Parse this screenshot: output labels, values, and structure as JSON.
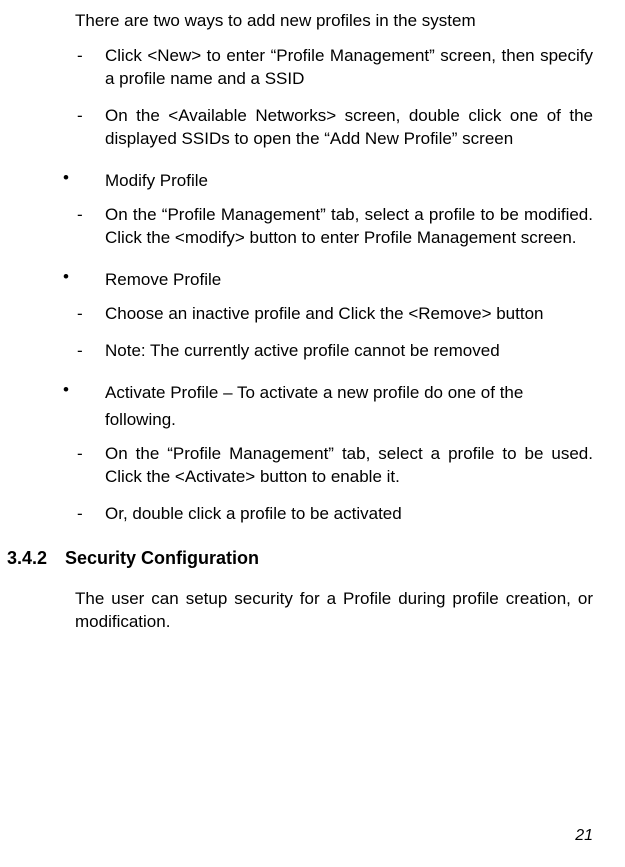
{
  "intro": "There are two ways to add new profiles in the system",
  "addMethods": {
    "item1": "Click <New> to enter “Profile Management” screen, then specify a profile name and a SSID",
    "item2": "On the <Available Networks> screen, double click one of the displayed SSIDs to open the “Add New Profile” screen"
  },
  "modify": {
    "title": "Modify Profile",
    "item1": "On the “Profile Management” tab, select a profile to be modified. Click the <modify> button to enter Profile Management screen."
  },
  "remove": {
    "title": "Remove Profile",
    "item1": "Choose an inactive profile and Click the <Remove> button",
    "item2": "Note: The currently active profile cannot be removed"
  },
  "activate": {
    "title": "Activate Profile – To activate a new profile do one of the following.",
    "item1": "On the “Profile Management” tab, select a profile to be used. Click the <Activate> button to enable it.",
    "item2": "Or, double click a profile to be activated"
  },
  "section": {
    "number": "3.4.2",
    "title": "Security Configuration",
    "body": "The user can setup security for a Profile during profile creation, or modification."
  },
  "pageNumber": "21",
  "markers": {
    "dash": "-",
    "bullet": "•"
  }
}
